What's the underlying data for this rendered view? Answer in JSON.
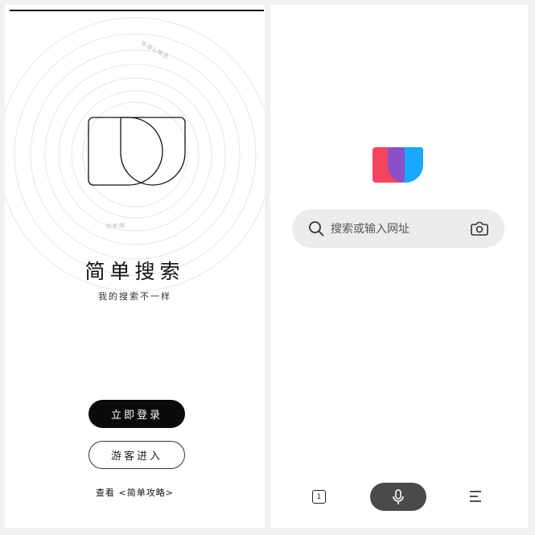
{
  "left_screen": {
    "app_name": "简单搜索",
    "slogan": "我的搜索不一样",
    "ring_label_top": "热搜&精选",
    "ring_label_bottom": "听新闻",
    "login_button": "立即登录",
    "guest_button": "游客进入",
    "guide_link": "查看 <简单攻略>"
  },
  "right_screen": {
    "search": {
      "placeholder": "搜索或输入网址"
    },
    "bottom_bar": {
      "tab_count": "1"
    },
    "icons": [
      "search-icon",
      "camera-icon",
      "tabs-icon",
      "microphone-icon",
      "menu-icon"
    ]
  },
  "colors": {
    "logo_red": "#f4455e",
    "logo_blue": "#1aa7ff",
    "logo_overlap": "#8b4fc8",
    "voice_button": "#4a4a4a",
    "login_button": "#0a0a0a",
    "search_bg": "#ececee"
  }
}
